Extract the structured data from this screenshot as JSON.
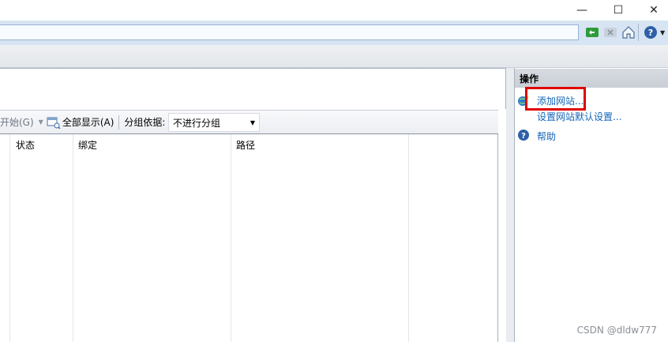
{
  "window": {
    "minimize_glyph": "—",
    "maximize_glyph": "☐",
    "close_glyph": "✕"
  },
  "toolbar_icons": [
    "refresh-icon",
    "stop-icon",
    "home-icon",
    "help-icon"
  ],
  "filter_bar": {
    "start_label": "开始(G)",
    "show_all_label": "全部显示(A)",
    "group_by_label": "分组依据:",
    "group_by_value": "不进行分组"
  },
  "table": {
    "columns": [
      "状态",
      "绑定",
      "路径"
    ]
  },
  "actions_panel": {
    "title": "操作",
    "add_website": "添加网站...",
    "set_defaults": "设置网站默认设置...",
    "help": "帮助"
  },
  "watermark": "CSDN @dldw777",
  "colors": {
    "link": "#1566b8",
    "highlight_box": "#e00000",
    "address_band": "#d6e4f3"
  }
}
